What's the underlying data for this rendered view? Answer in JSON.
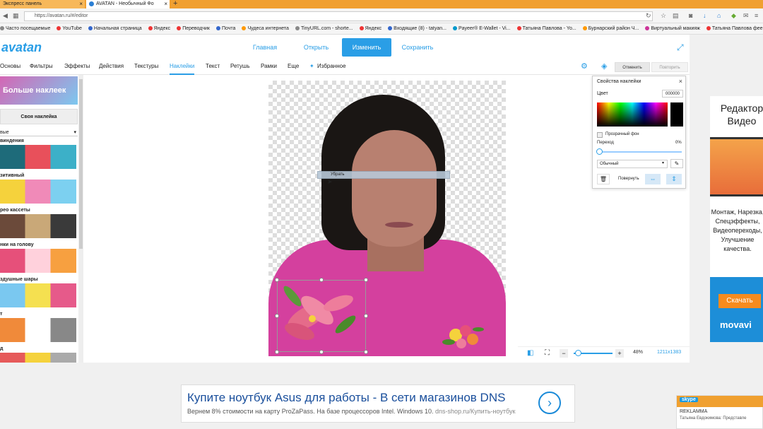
{
  "browser": {
    "tabs": [
      {
        "title": "Экспресс панель"
      },
      {
        "title": "AVATAN - Необычный Фо"
      }
    ],
    "new_tab": "+",
    "url": "https://avatan.ru/#/editor",
    "bookmarks": [
      "Часто посещаемые",
      "YouTube",
      "Начальная страница",
      "Яндекс",
      "Переводчик",
      "Почта",
      "Чудеса интернета",
      "TinyURL.com - shorte...",
      "Яндекс",
      "Входящие (8) - tatyan...",
      "Payeer® E-Wallet - Vi...",
      "Татьяна Павлова - Yo...",
      "Бурнарский район Ч...",
      "Виртуальный макияж",
      "Татьяна Павлова фее..."
    ]
  },
  "app": {
    "logo": "avatan",
    "nav": {
      "home": "Главная",
      "open": "Открыть",
      "change": "Изменить",
      "save": "Сохранить"
    },
    "toolbar": {
      "basics": "Основы",
      "filters": "Фильтры",
      "effects": "Эффекты",
      "actions": "Действия",
      "textures": "Текстуры",
      "stickers": "Наклейки",
      "text": "Текст",
      "retouch": "Ретушь",
      "frames": "Рамки",
      "more": "Еще",
      "favorites": "Избранное"
    },
    "undo": "Отменить",
    "redo": "Повторить"
  },
  "sidebar": {
    "more_stickers": "Больше наклеек",
    "own_sticker": "Своя наклейка",
    "category_select": "вые",
    "categories": [
      {
        "label": "виндения",
        "colors": [
          "#1e6b7a",
          "#e8505b",
          "#3cb0c8"
        ]
      },
      {
        "label": "зитивный",
        "colors": [
          "#f5d23c",
          "#f08ab8",
          "#7cd0f0"
        ]
      },
      {
        "label": "рео кассеты",
        "colors": [
          "#6b4a3a",
          "#c9a878",
          "#3a3a3a"
        ]
      },
      {
        "label": "нки на голову",
        "colors": [
          "#e6507a",
          "#ffd1dc",
          "#f7a040"
        ]
      },
      {
        "label": "здушные шары",
        "colors": [
          "#7ac8f0",
          "#f5e050",
          "#e65a8a"
        ]
      },
      {
        "label": "т",
        "colors": [
          "#f08a3a",
          "#ffffff",
          "#888888"
        ]
      },
      {
        "label": "д",
        "colors": [
          "#e65a5a",
          "#f5d23c",
          "#aaaaaa"
        ]
      }
    ]
  },
  "canvas": {
    "tooltip": "Убрать",
    "zoom_minus": "−",
    "zoom_plus": "+",
    "zoom_percent": "48%",
    "zoom_level": 0.1,
    "image_dims": "1211x1383"
  },
  "properties": {
    "title": "Свойства наклейки",
    "close": "×",
    "color_label": "Цвет",
    "color_hex": "000000",
    "transparent_bg": "Прозрачный фон",
    "transition_label": "Переход",
    "transition_value": "0%",
    "blend_mode": "Обычный",
    "rotate": "Повернуть"
  },
  "right_ad": {
    "title": "Редактор Видео",
    "description": "Монтаж, Нарезка, Спецэффекты, Видеопереходы, Улучшение качества.",
    "download": "Скачать",
    "brand": "movavi"
  },
  "bottom_ad": {
    "title": "Купите ноутбук Asus для работы - В сети магазинов DNS",
    "subtitle": "Вернем 8% стоимости на карту ProZaPass. На базе процессоров Intel. Windows 10.",
    "url": "dns-shop.ru/Купить-ноутбук"
  },
  "skype": {
    "logo": "skype",
    "name": "REKLAMMA",
    "message": "Татьяна Евдокимова: Представле"
  }
}
